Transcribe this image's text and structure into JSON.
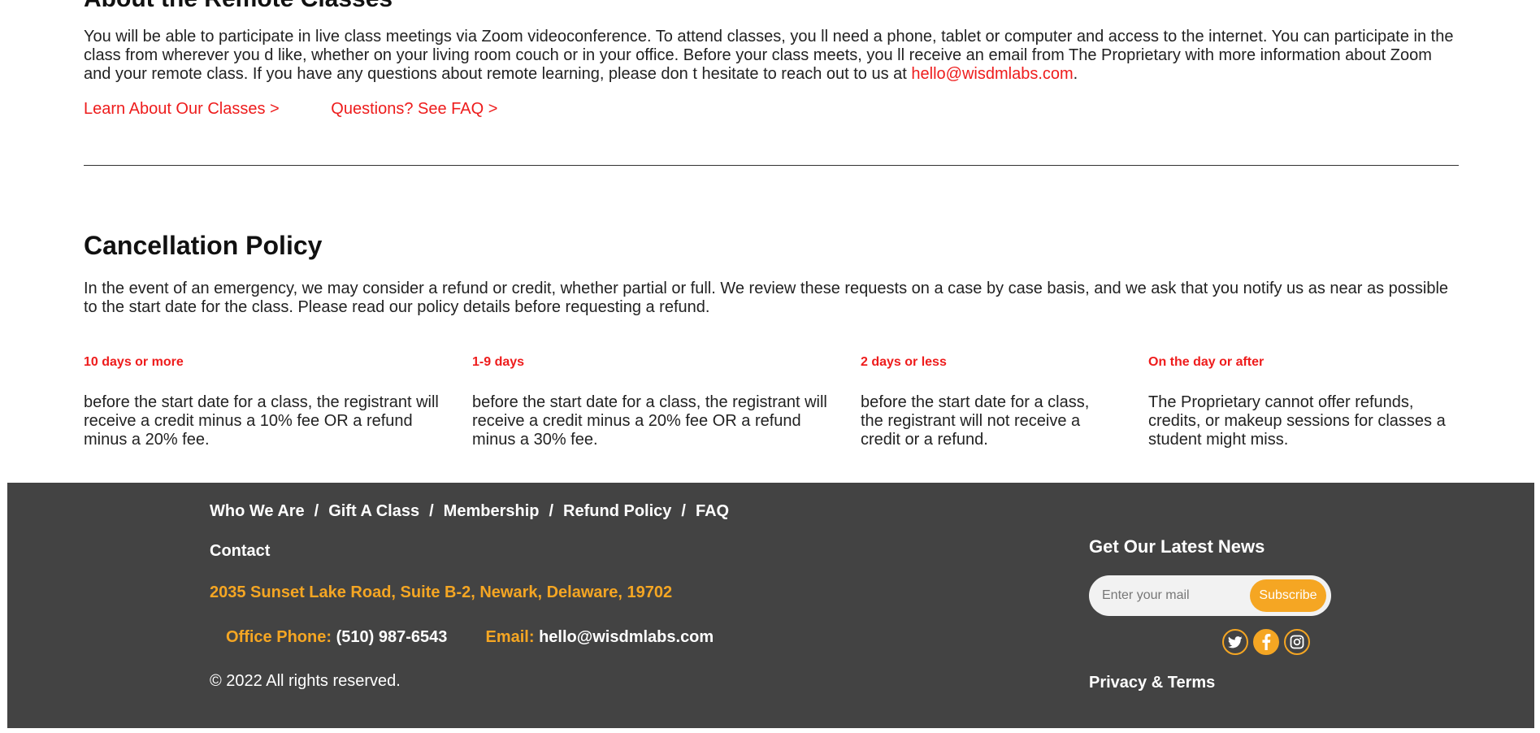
{
  "about": {
    "heading": "About the Remote Classes",
    "intro_text": "You will be able to participate in live class meetings via Zoom videoconference. To attend classes, you ll need a phone, tablet or computer and access to the internet. You can participate in the class from wherever you d like, whether on your living room couch or in your office. Before your class meets, you ll receive an email from The Proprietary with more information about Zoom and your remote class. If you have any questions about remote learning, please don t hesitate to reach out to us at ",
    "email_link": "hello@wisdmlabs.com",
    "period": ".",
    "learn_link": "Learn About Our Classes >",
    "faq_link": "Questions? See FAQ >"
  },
  "cancellation": {
    "title": "Cancellation Policy",
    "text": "In the event of an emergency, we may consider a refund or credit, whether partial or full. We review these requests on a case by case basis, and we ask that you notify us as near as possible to the start date for the class. Please read our policy details before requesting a refund.",
    "columns": [
      {
        "label": "10 days or more",
        "desc": "before the start date for a class, the registrant will receive a credit minus a 10% fee OR a refund minus a 20% fee."
      },
      {
        "label": "1-9 days",
        "desc": "before the start date for a class, the registrant will receive a credit minus a 20% fee OR a refund minus a 30% fee."
      },
      {
        "label": "2 days or less",
        "desc": "before the start date for a class, the registrant will not receive a credit or a refund."
      },
      {
        "label": "On the day or after",
        "desc": "The Proprietary cannot offer refunds, credits, or makeup sessions for classes a student might miss."
      }
    ]
  },
  "footer": {
    "nav": [
      "Who We Are",
      "Gift A Class",
      "Membership",
      "Refund Policy",
      "FAQ"
    ],
    "separator": "/",
    "contact": "Contact",
    "address": "2035 Sunset Lake Road, Suite B-2, Newark, Delaware, 19702",
    "phone_label": "Office Phone:",
    "phone_value": "(510) 987-6543",
    "email_label": "Email:",
    "email_value": "hello@wisdmlabs.com",
    "copyright": "© 2022 All rights reserved.",
    "news_title": "Get Our Latest News",
    "subscribe_placeholder": "Enter your mail",
    "subscribe_button": "Subscribe",
    "socials": [
      "twitter-icon",
      "facebook-icon",
      "instagram-icon"
    ],
    "privacy": "Privacy & Terms"
  },
  "colors": {
    "accent_red": "#ee1c1c",
    "accent_orange": "#f5a623",
    "footer_bg": "#434343"
  }
}
